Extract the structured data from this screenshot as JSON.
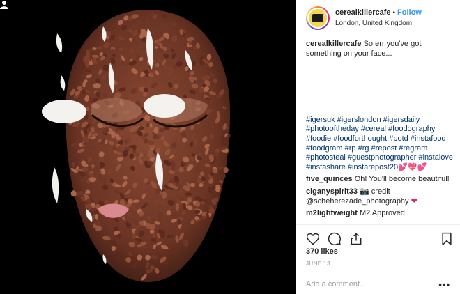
{
  "post": {
    "username": "cerealkillercafe",
    "separator": "•",
    "follow_label": "Follow",
    "location": "London, United Kingdom",
    "avatar": "cereal-killer-cafe-logo"
  },
  "caption": {
    "username": "cerealkillercafe",
    "text": "So err you've got something on your face...",
    "dots": [
      ".",
      ".",
      ".",
      ".",
      ".",
      "."
    ],
    "hashtag_lines": [
      "#igersuk #igerslondon #igersdaily",
      "#photooftheday #cereal #foodography",
      "#foodie #foodforthought #potd #instafood",
      "#foodgram #rp #rg #repost #regram",
      "#photosteal #guestphotographer #instalove",
      "#instashare #instarepost20"
    ],
    "hearts": "💕💖💕"
  },
  "comments": [
    {
      "username": "five_quinces",
      "text": "Oh! You'll become beautiful!"
    },
    {
      "username": "ciganyspirit33",
      "text": "📷 credit @scheherezade_photography",
      "emoji": "❤"
    },
    {
      "username": "m2lightweight",
      "text": "M2 Approved"
    }
  ],
  "actions": {
    "like_icon": "heart-icon",
    "comment_icon": "comment-icon",
    "share_icon": "share-icon",
    "save_icon": "bookmark-icon"
  },
  "likes": "370 likes",
  "date": "JUNE 13",
  "add_comment": {
    "placeholder": "Add a comment...",
    "more": "•••"
  },
  "colors": {
    "link": "#3897f0",
    "hashtag": "#003569",
    "photo_bg": "#000000"
  }
}
